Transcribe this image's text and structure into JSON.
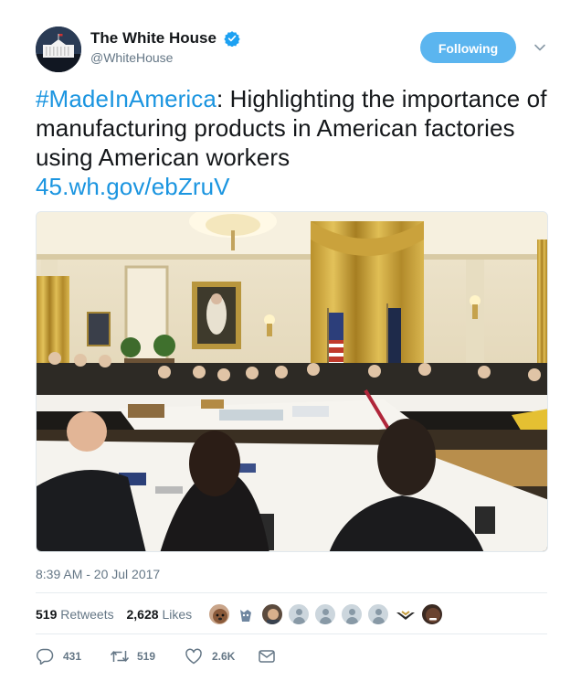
{
  "author": {
    "display_name": "The White House",
    "handle": "@WhiteHouse",
    "verified": true,
    "follow_label": "Following",
    "accent_color": "#5bb5ef"
  },
  "tweet": {
    "hashtag": "#MadeInAmerica",
    "text_rest": ": Highlighting the importance of manufacturing products in American factories using American workers",
    "link": "45.wh.gov/ebZruV",
    "link_color": "#1b95e0"
  },
  "photo": {
    "description_icon": "photo-image"
  },
  "timestamp": "8:39 AM - 20 Jul 2017",
  "stats": {
    "retweets_count": "519",
    "retweets_label": "Retweets",
    "likes_count": "2,628",
    "likes_label": "Likes"
  },
  "likers": [
    {
      "icon": "dog-avatar"
    },
    {
      "icon": "dog-avatar-2"
    },
    {
      "icon": "person-avatar"
    },
    {
      "icon": "default-avatar"
    },
    {
      "icon": "default-avatar"
    },
    {
      "icon": "default-avatar"
    },
    {
      "icon": "default-avatar"
    },
    {
      "icon": "logo-avatar"
    },
    {
      "icon": "face-avatar"
    }
  ],
  "actions": {
    "reply_count": "431",
    "retweet_count": "519",
    "like_count": "2.6K"
  }
}
